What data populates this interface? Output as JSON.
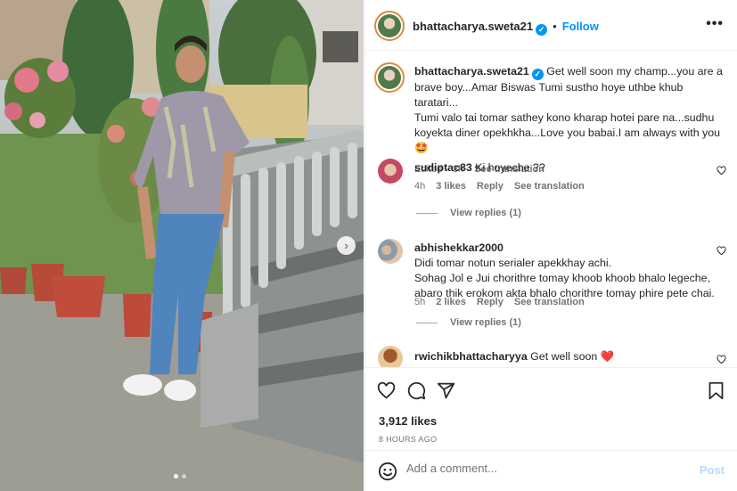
{
  "post": {
    "author": "bhattacharya.sweta21",
    "header_separator": "•",
    "follow_label": "Follow",
    "more_label": "•••",
    "caption_author": "bhattacharya.sweta21",
    "caption_lines": [
      "Get well soon my champ...you are a",
      "brave boy...Amar Biswas Tumi sustho hoye uthbe khub taratari...",
      "Tumi valo tai tomar sathey kono kharap hotei pare na...sudhu",
      "koyekta diner opekhkha...Love you babai.I am always with you🤩"
    ],
    "caption_edited": "Edited",
    "caption_dot": "·",
    "caption_time": "3h",
    "caption_translate": "See translation"
  },
  "comments": [
    {
      "username": "sudiptac83",
      "text": "Ki hoyeche ??",
      "time": "4h",
      "likes": "3 likes",
      "reply": "Reply",
      "translate": "See translation",
      "view_replies": "View replies (1)"
    },
    {
      "username": "abhishekkar2000",
      "lines": [
        "Didi tomar notun serialer apekkhay achi.",
        "Sohag Jol e Jui chorithre tomay khoob khoob bhalo legeche,",
        "abaro thik erokom akta bhalo chorithre tomay phire pete chai."
      ],
      "time": "5h",
      "likes": "2 likes",
      "reply": "Reply",
      "translate": "See translation",
      "view_replies": "View replies (1)"
    },
    {
      "username": "rwichikbhattacharyya",
      "text": "Get well soon",
      "emoji": "❤️"
    }
  ],
  "footer": {
    "likes": "3,912 likes",
    "time": "8 HOURS AGO",
    "add_comment_placeholder": "Add a comment...",
    "post_label": "Post"
  },
  "carousel": {
    "pages": 2,
    "current": 1
  },
  "colors": {
    "accent": "#0095f6",
    "text": "#262626",
    "muted": "#737373",
    "heart_red": "#ed4956",
    "divider": "#efefef"
  },
  "icons": [
    "more-icon",
    "verified-icon",
    "heart-icon",
    "comment-icon",
    "share-icon",
    "bookmark-icon",
    "emoji-icon",
    "next-arrow-icon"
  ]
}
